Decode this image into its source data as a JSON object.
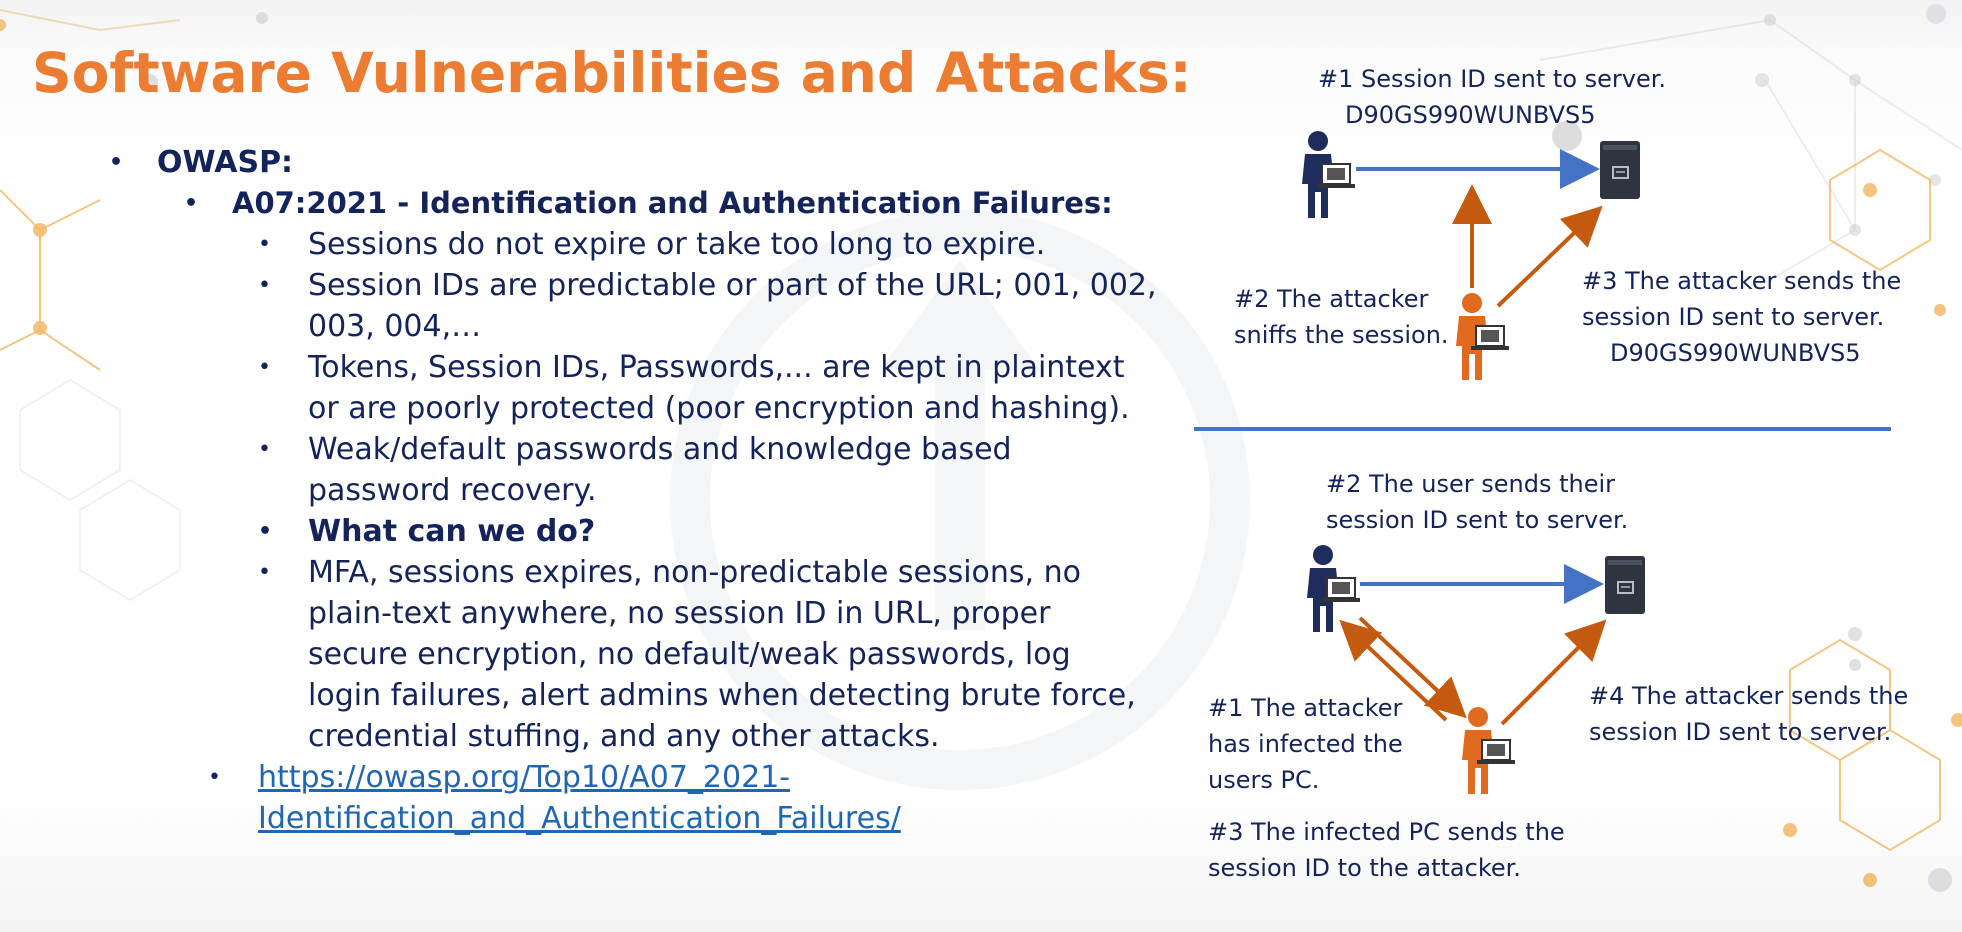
{
  "slide": {
    "title": "Software Vulnerabilities and Attacks:",
    "bullets": {
      "owasp": "OWASP:",
      "a07": "A07:2021 - Identification and Authentication Failures:",
      "items": [
        "Sessions do not expire or take too long to expire.",
        "Session IDs are predictable or part of the URL; 001, 002,",
        "003, 004,…",
        "Tokens, Session IDs, Passwords,... are kept in plaintext",
        "or are poorly protected (poor encryption and hashing).",
        "Weak/default passwords and knowledge based",
        "password recovery.",
        "What can we do?",
        "MFA, sessions expires, non-predictable sessions, no",
        "plain-text anywhere, no session ID in URL, proper",
        "secure encryption, no default/weak passwords, log",
        "login failures, alert admins when detecting brute force,",
        "credential stuffing, and any other attacks."
      ],
      "link_line1": "https://owasp.org/Top10/A07_2021-",
      "link_line2": "Identification_and_Authentication_Failures/"
    },
    "top_diagram": {
      "step1_line1": "#1 Session ID sent to server.",
      "step1_line2": "D90GS990WUNBVS5",
      "step2_line1": "#2 The attacker",
      "step2_line2": "sniffs the session.",
      "step3_line1": "#3 The attacker sends the",
      "step3_line2": "session ID sent to server.",
      "step3_line3": "D90GS990WUNBVS5"
    },
    "bottom_diagram": {
      "step2_line1": "#2 The user sends their",
      "step2_line2": "session ID sent to server.",
      "step1_line1": "#1 The attacker",
      "step1_line2": "has infected the",
      "step1_line3": "users PC.",
      "step3_line1": "#3 The infected PC sends the",
      "step3_line2": "session ID to the attacker.",
      "step4_line1": "#4 The attacker sends the",
      "step4_line2": "session ID sent to server."
    },
    "colors": {
      "title": "#ec7c31",
      "text": "#14235a",
      "link": "#1f66b5",
      "arrow_blue": "#4472c4",
      "arrow_orange": "#c55a11",
      "user": "#1f2d5c",
      "attacker": "#e06a1f",
      "server": "#2e3440"
    },
    "icons": [
      "user-icon",
      "attacker-icon",
      "laptop-icon",
      "server-icon"
    ]
  }
}
